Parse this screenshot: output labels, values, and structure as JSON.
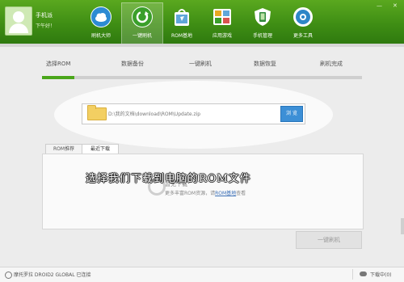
{
  "user": {
    "name": "手机派",
    "greeting": "下午好！"
  },
  "nav": {
    "items": [
      {
        "label": "刷机大师",
        "icon": "cloud-icon",
        "color": "#2d8bd3"
      },
      {
        "label": "一键刷机",
        "icon": "refresh-icon",
        "color": "#3a9f2a"
      },
      {
        "label": "ROM基地",
        "icon": "shopping-bag-icon",
        "color": "#5fa6d9"
      },
      {
        "label": "应用游戏",
        "icon": "apps-icon",
        "color": "#e7a823"
      },
      {
        "label": "手机管理",
        "icon": "phone-shield-icon",
        "color": "#2f8a3b"
      },
      {
        "label": "更多工具",
        "icon": "tools-icon",
        "color": "#2e86c7"
      }
    ]
  },
  "window_controls": {
    "minimize": "—",
    "close": "✕"
  },
  "steps": [
    "选择ROM",
    "数据备份",
    "一键刷机",
    "数据恢复",
    "刷机完成"
  ],
  "progress": {
    "fraction": 0.1
  },
  "rom_path": {
    "value": "D:\\我的文档\\download\\ROM\\Update.zip",
    "browse_label": "浏 览"
  },
  "tabs": [
    "ROM推荐",
    "最近下载"
  ],
  "empty_state": {
    "title": "暂无下载",
    "hint_prefix": "更多丰富ROM资源，请",
    "hint_link": "ROM基地",
    "hint_suffix": "查看"
  },
  "overlay_caption": "选择我们下载到电脑的ROM文件",
  "flash_button": "一键刷机",
  "status": {
    "device": "摩托罗拉 DROID2 GLOBAL 已连接",
    "downloads": "下载中(0)"
  },
  "colors": {
    "brand_green": "#3f8e14",
    "accent_blue": "#3c8fd6",
    "progress_green": "#4aa61a"
  }
}
